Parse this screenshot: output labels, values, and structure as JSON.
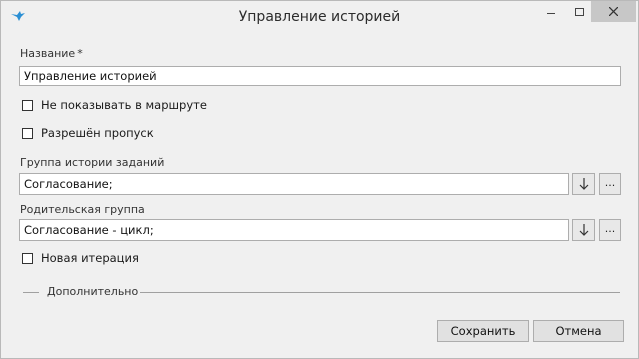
{
  "window": {
    "title": "Управление историей"
  },
  "form": {
    "name_label": "Название",
    "name_required_mark": "*",
    "name_value": "Управление историей",
    "hide_in_route_label": "Не показывать в маршруте",
    "skip_allowed_label": "Разрешён пропуск",
    "task_history_group_label": "Группа истории заданий",
    "task_history_group_value": "Согласование;",
    "parent_group_label": "Родительская группа",
    "parent_group_value": "Согласование - цикл;",
    "new_iteration_label": "Новая итерация",
    "ellipsis": "...",
    "additional_section_label": "Дополнительно"
  },
  "checkboxes": {
    "hide_in_route": false,
    "skip_allowed": false,
    "new_iteration": false
  },
  "buttons": {
    "save": "Сохранить",
    "cancel": "Отмена"
  },
  "icons": {
    "app": "bird-icon",
    "minimize": "minimize-icon",
    "maximize": "maximize-icon",
    "close": "close-icon",
    "dropdown": "arrow-down-icon"
  },
  "colors": {
    "app_icon": "#2a8fd4",
    "close_button_bg": "#c7c7c7"
  }
}
